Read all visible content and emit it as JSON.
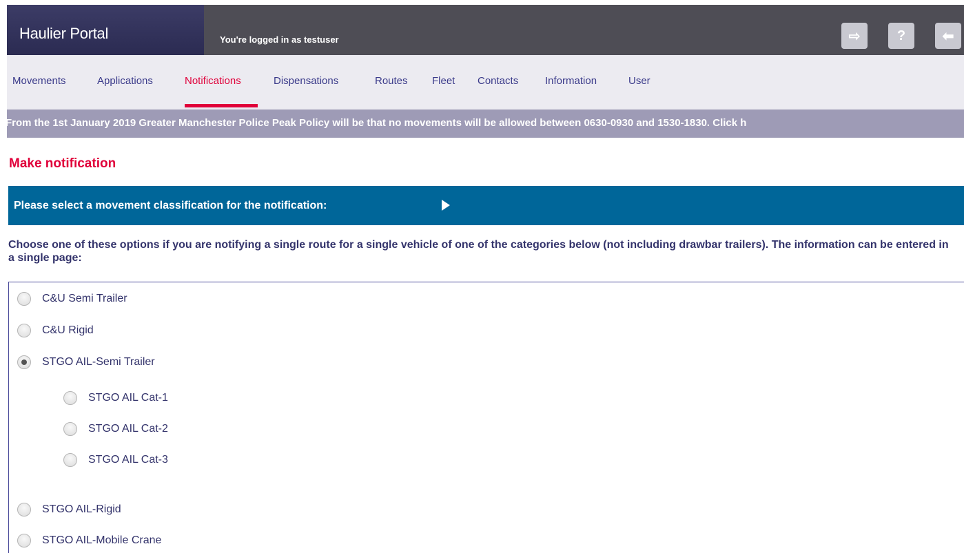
{
  "header": {
    "brand": "Haulier Portal",
    "login_text": "You're logged in as testuser",
    "buttons": [
      {
        "name": "logout",
        "glyph": "⇨"
      },
      {
        "name": "help",
        "glyph": "?"
      },
      {
        "name": "back",
        "glyph": "⬅"
      }
    ]
  },
  "nav": {
    "items": [
      "Movements",
      "Applications",
      "Notifications",
      "Dispensations",
      "Routes",
      "Fleet",
      "Contacts",
      "Information",
      "User"
    ],
    "active": "Notifications"
  },
  "banner": {
    "text": "From the 1st January 2019 Greater Manchester Police Peak Policy will be that no movements will be allowed between 0630-0930 and 1530-1830. Click h"
  },
  "page": {
    "title": "Make notification",
    "classification_prompt": "Please select a movement classification for the notification:",
    "instructions": "Choose one of these options if you are notifying a single route for a single vehicle of one of the categories below (not including drawbar trailers). The information can be entered in a single page:"
  },
  "options": {
    "items": [
      {
        "label": "C&U Semi Trailer",
        "checked": false
      },
      {
        "label": "C&U Rigid",
        "checked": false
      },
      {
        "label": "STGO AIL-Semi Trailer",
        "checked": true
      },
      {
        "label": "STGO AIL Cat-1",
        "checked": false
      },
      {
        "label": "STGO AIL Cat-2",
        "checked": false
      },
      {
        "label": "STGO AIL Cat-3",
        "checked": false
      },
      {
        "label": "STGO AIL-Rigid",
        "checked": false
      },
      {
        "label": "STGO AIL-Mobile Crane",
        "checked": false
      }
    ]
  },
  "colors": {
    "accent": "#e0003a",
    "primary_bar": "#006699",
    "text": "#33336b"
  }
}
